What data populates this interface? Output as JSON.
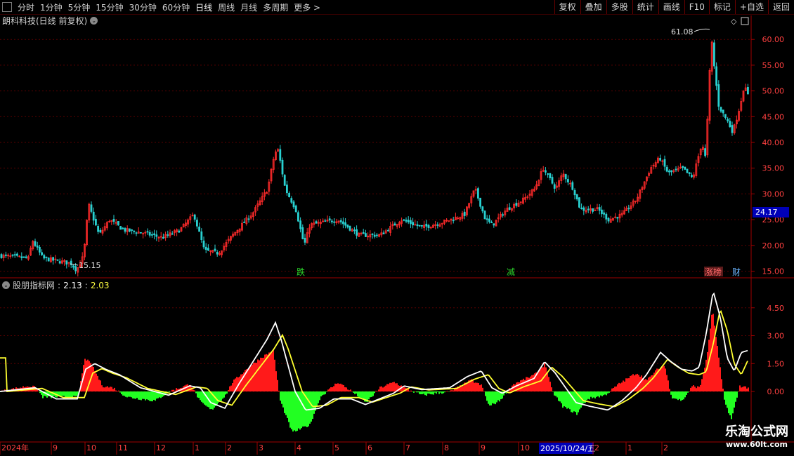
{
  "toolbar": {
    "periods": [
      "分时",
      "1分钟",
      "5分钟",
      "15分钟",
      "30分钟",
      "60分钟",
      "日线",
      "周线",
      "月线",
      "多周期",
      "更多 >"
    ],
    "active_period": "日线",
    "right_buttons": [
      "复权",
      "叠加",
      "多股",
      "统计",
      "画线",
      "F10",
      "标记",
      "+自选",
      "返回"
    ]
  },
  "stock": {
    "title": "朗科科技(日线 前复权)"
  },
  "price_panel": {
    "yticks": [
      "60.00",
      "55.00",
      "50.00",
      "45.00",
      "40.00",
      "35.00",
      "30.00",
      "25.00",
      "20.00",
      "15.00"
    ],
    "high_label": "61.08",
    "low_label": "15.15",
    "current_price": "24.17",
    "events": [
      {
        "text": "跌",
        "color": "#2bd62b",
        "x": 428
      },
      {
        "text": "减",
        "color": "#2bd62b",
        "x": 727
      },
      {
        "text": "涨榜",
        "color": "#ff6a6a",
        "bg": "#5a1a1a",
        "x": 1015
      },
      {
        "text": "财",
        "color": "#6ab4ff",
        "x": 1048
      }
    ]
  },
  "indicator": {
    "name": "股朋指标网",
    "value1": "2.13",
    "value2": "2.03",
    "value2_color": "#ffff40",
    "yticks": [
      "4.50",
      "3.00",
      "1.50",
      "0.00"
    ]
  },
  "x_axis": {
    "labels": [
      {
        "text": "2024年",
        "x": 2
      },
      {
        "text": "9",
        "x": 75
      },
      {
        "text": "10",
        "x": 123
      },
      {
        "text": "11",
        "x": 168
      },
      {
        "text": "12",
        "x": 222
      },
      {
        "text": "1",
        "x": 277
      },
      {
        "text": "2",
        "x": 323
      },
      {
        "text": "3",
        "x": 368
      },
      {
        "text": "4",
        "x": 422
      },
      {
        "text": "5",
        "x": 476
      },
      {
        "text": "6",
        "x": 523
      },
      {
        "text": "7",
        "x": 577
      },
      {
        "text": "8",
        "x": 632
      },
      {
        "text": "9",
        "x": 684
      },
      {
        "text": "10",
        "x": 740
      }
    ],
    "cursor_date": "2025/10/24/五",
    "labels_after": [
      {
        "text": "2",
        "x": 846
      },
      {
        "text": "1",
        "x": 893
      },
      {
        "text": "2",
        "x": 944
      }
    ]
  },
  "watermark": {
    "name": "乐淘公式网",
    "url": "www.60lt.com"
  },
  "colors": {
    "up": "#ff2a2a",
    "down": "#28d0d0",
    "hist_up": "#ff1a1a",
    "hist_down": "#22ff22",
    "line1": "#ffffff",
    "line2": "#ffff30"
  }
}
